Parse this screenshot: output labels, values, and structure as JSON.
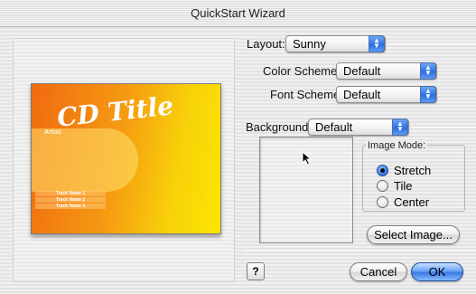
{
  "window": {
    "title": "QuickStart Wizard"
  },
  "preview": {
    "cd_title": "CD Title",
    "artist": "Artist",
    "tracks": [
      "Track Name 1",
      "Track Name 2",
      "Track Name 3"
    ]
  },
  "layout": {
    "label": "Layout:",
    "value": "Sunny"
  },
  "color_scheme": {
    "label": "Color Scheme:",
    "value": "Default"
  },
  "font_scheme": {
    "label": "Font Scheme:",
    "value": "Default"
  },
  "background": {
    "label": "Background:",
    "value": "Default"
  },
  "image_mode": {
    "title": "Image Mode:",
    "options": [
      {
        "label": "Stretch",
        "selected": true
      },
      {
        "label": "Tile",
        "selected": false
      },
      {
        "label": "Center",
        "selected": false
      }
    ]
  },
  "buttons": {
    "select_image": "Select Image...",
    "help": "?",
    "cancel": "Cancel",
    "ok": "OK"
  },
  "colors": {
    "accent": "#3a7ae3",
    "art_orange": "#f06a10",
    "art_yellow": "#fbe600"
  }
}
